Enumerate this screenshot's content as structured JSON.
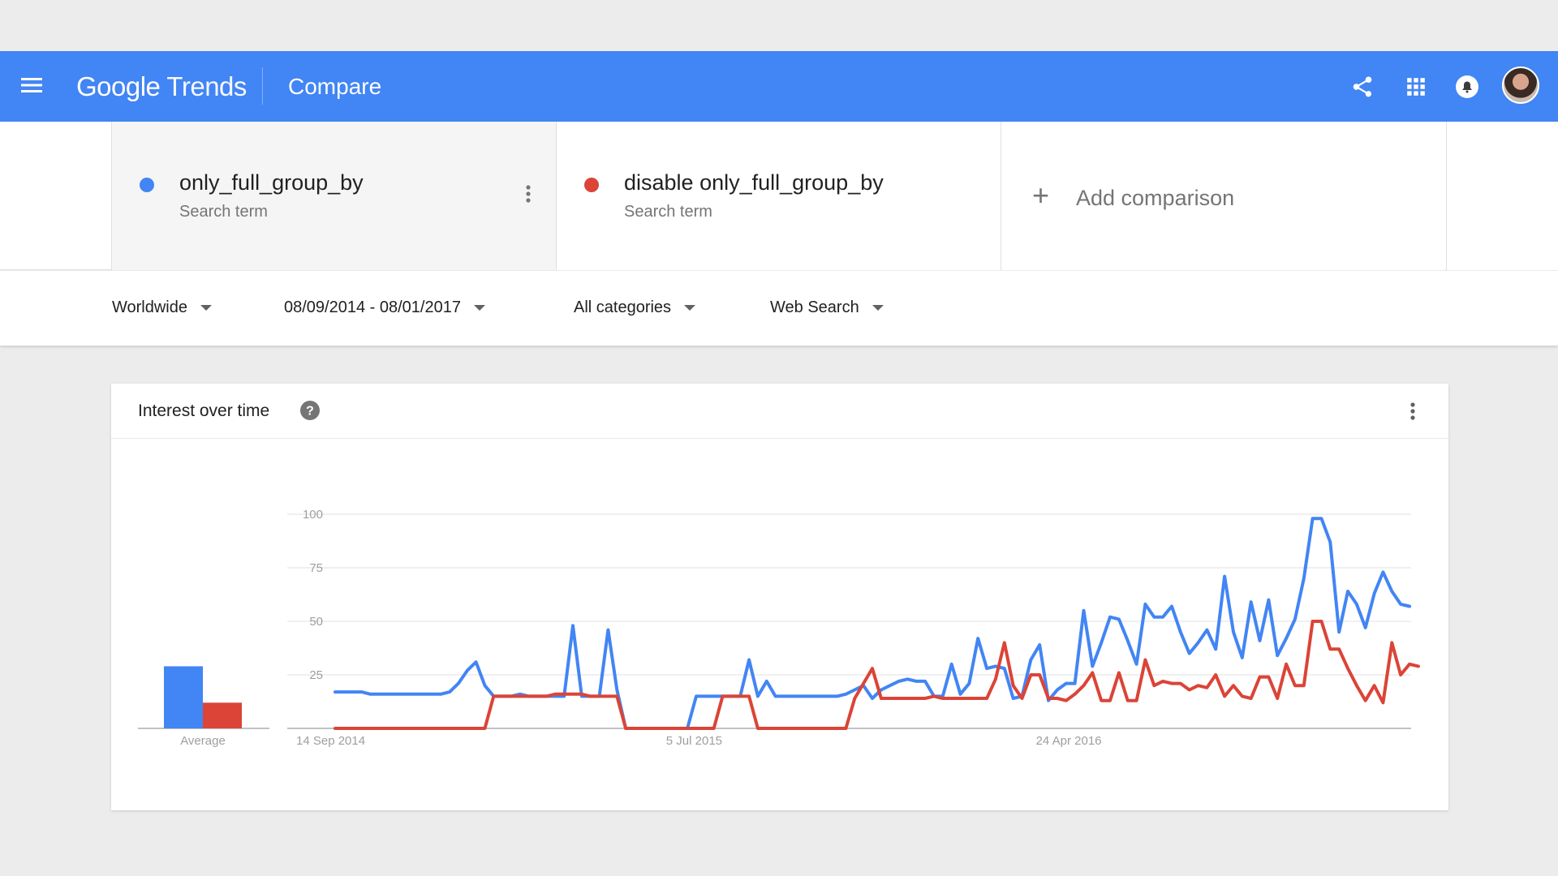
{
  "appbar": {
    "logo_google": "Google",
    "logo_trends": "Trends",
    "title": "Compare"
  },
  "terms": [
    {
      "name": "only_full_group_by",
      "subtitle": "Search term",
      "color": "#4285f4"
    },
    {
      "name": "disable only_full_group_by",
      "subtitle": "Search term",
      "color": "#db4437"
    }
  ],
  "add_comparison": {
    "label": "Add comparison",
    "icon": "+"
  },
  "filters": {
    "region": "Worldwide",
    "date_range": "08/09/2014 - 08/01/2017",
    "category": "All categories",
    "search_type": "Web Search"
  },
  "card": {
    "title": "Interest over time"
  },
  "chart_data": {
    "type": "line",
    "title": "Interest over time",
    "ylim": [
      0,
      100
    ],
    "yticks": [
      25,
      50,
      75,
      100
    ],
    "y_tick_labels": [
      "25",
      "50",
      "75",
      "100"
    ],
    "x_tick_labels": [
      "14 Sep 2014",
      "5 Jul 2015",
      "24 Apr 2016"
    ],
    "x_tick_index": [
      0,
      42,
      84
    ],
    "grid": true,
    "average_label": "Average",
    "averages": [
      29,
      12
    ],
    "series": [
      {
        "name": "only_full_group_by",
        "color": "#4285f4",
        "values": [
          17,
          17,
          17,
          17,
          16,
          16,
          16,
          16,
          16,
          16,
          16,
          16,
          16,
          17,
          21,
          27,
          31,
          20,
          15,
          15,
          15,
          16,
          15,
          15,
          15,
          15,
          15,
          48,
          15,
          15,
          15,
          46,
          18,
          0,
          0,
          0,
          0,
          0,
          0,
          0,
          0,
          15,
          15,
          15,
          15,
          15,
          15,
          32,
          15,
          22,
          15,
          15,
          15,
          15,
          15,
          15,
          15,
          15,
          16,
          18,
          20,
          14,
          18,
          20,
          22,
          23,
          22,
          22,
          15,
          15,
          30,
          16,
          21,
          42,
          28,
          29,
          28,
          14,
          15,
          32,
          39,
          13,
          18,
          21,
          21,
          55,
          29,
          40,
          52,
          51,
          41,
          30,
          58,
          52,
          52,
          57,
          45,
          35,
          40,
          46,
          37,
          71,
          45,
          33,
          59,
          41,
          60,
          34,
          42,
          51,
          70,
          98,
          98,
          87,
          45,
          64,
          58,
          47,
          63,
          73,
          64,
          58,
          57
        ]
      },
      {
        "name": "disable only_full_group_by",
        "color": "#db4437",
        "values": [
          0,
          0,
          0,
          0,
          0,
          0,
          0,
          0,
          0,
          0,
          0,
          0,
          0,
          0,
          0,
          0,
          0,
          0,
          15,
          15,
          15,
          15,
          15,
          15,
          15,
          16,
          16,
          16,
          16,
          15,
          15,
          15,
          15,
          0,
          0,
          0,
          0,
          0,
          0,
          0,
          0,
          0,
          0,
          0,
          15,
          15,
          15,
          15,
          0,
          0,
          0,
          0,
          0,
          0,
          0,
          0,
          0,
          0,
          0,
          14,
          21,
          28,
          14,
          14,
          14,
          14,
          14,
          14,
          15,
          14,
          14,
          14,
          14,
          14,
          14,
          23,
          40,
          20,
          14,
          25,
          25,
          14,
          14,
          13,
          16,
          20,
          26,
          13,
          13,
          26,
          13,
          13,
          32,
          20,
          22,
          21,
          21,
          18,
          20,
          19,
          25,
          15,
          20,
          15,
          14,
          24,
          24,
          14,
          30,
          20,
          20,
          50,
          50,
          37,
          37,
          28,
          20,
          13,
          20,
          12,
          40,
          25,
          30,
          29
        ]
      }
    ]
  }
}
